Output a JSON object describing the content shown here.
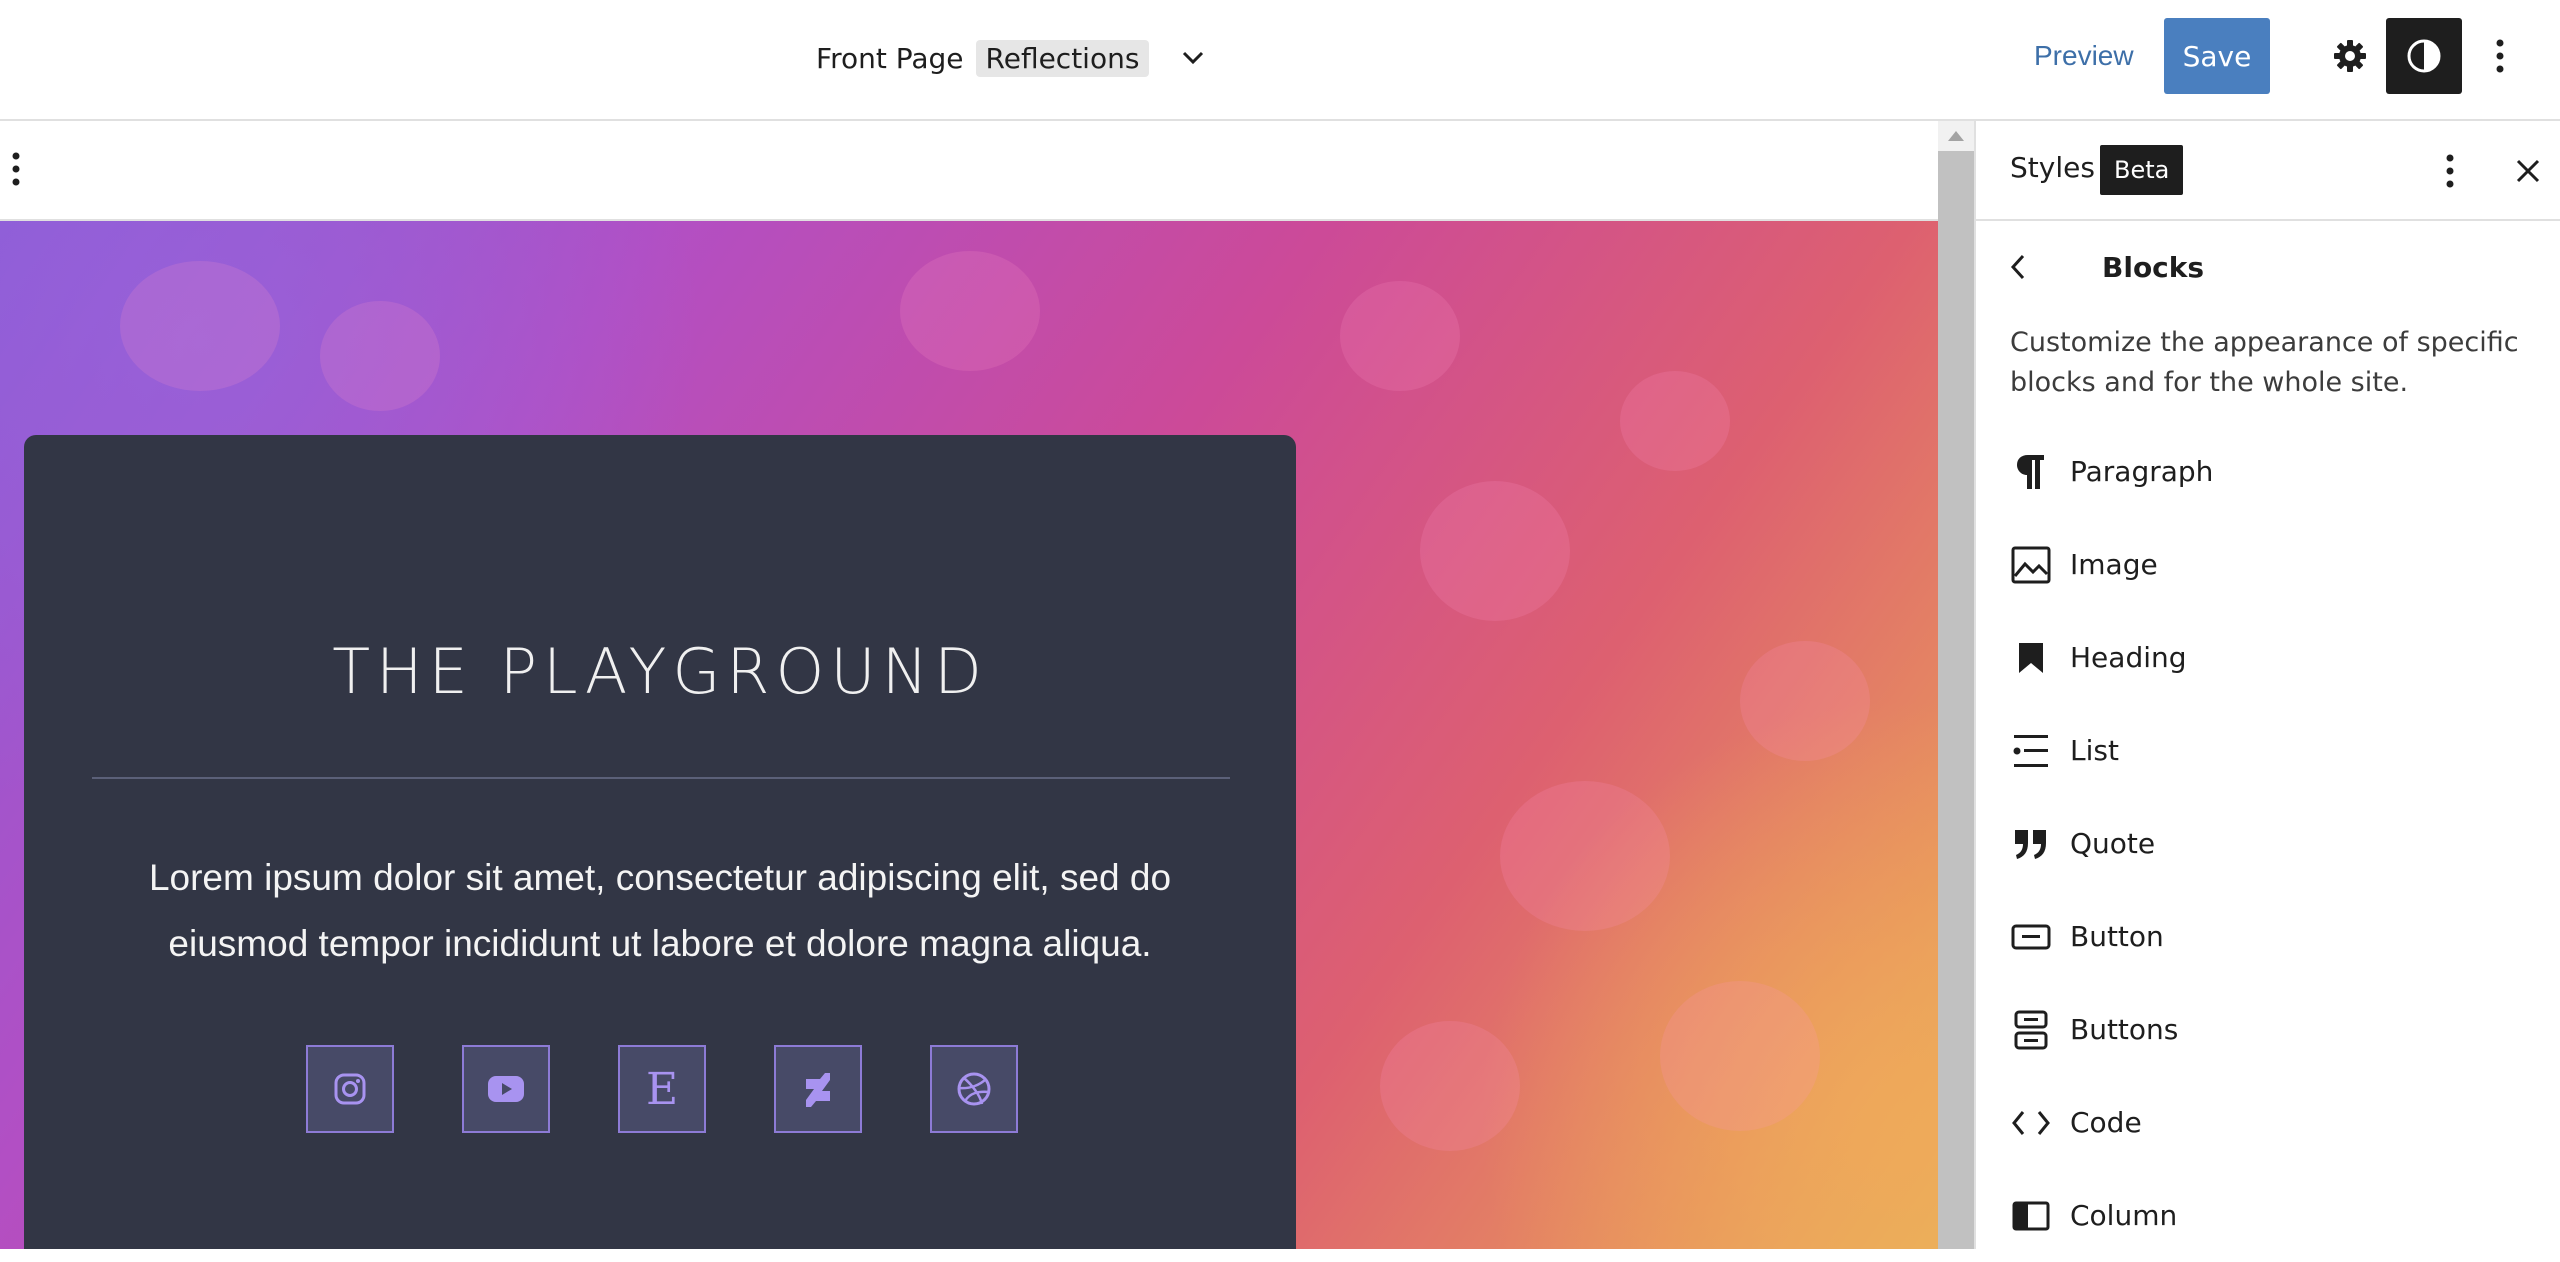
{
  "topbar": {
    "page_name": "Front Page",
    "template_badge": "Reflections",
    "preview_label": "Preview",
    "save_label": "Save"
  },
  "canvas": {
    "card_title": "THE PLAYGROUND",
    "card_text": "Lorem ipsum dolor sit amet, consectetur adipiscing elit, sed do eiusmod tempor incididunt ut labore et dolore magna aliqua.",
    "social_icons": [
      "instagram-icon",
      "youtube-icon",
      "etsy-icon",
      "deviantart-icon",
      "dribbble-icon"
    ],
    "etsy_letter": "E"
  },
  "sidebar": {
    "title": "Styles",
    "badge": "Beta",
    "section_title": "Blocks",
    "description": "Customize the appearance of specific blocks and for the whole site.",
    "blocks": [
      {
        "label": "Paragraph",
        "icon": "paragraph-icon"
      },
      {
        "label": "Image",
        "icon": "image-icon"
      },
      {
        "label": "Heading",
        "icon": "heading-icon"
      },
      {
        "label": "List",
        "icon": "list-icon"
      },
      {
        "label": "Quote",
        "icon": "quote-icon"
      },
      {
        "label": "Button",
        "icon": "button-icon"
      },
      {
        "label": "Buttons",
        "icon": "buttons-icon"
      },
      {
        "label": "Code",
        "icon": "code-icon"
      },
      {
        "label": "Column",
        "icon": "column-icon"
      }
    ]
  },
  "colors": {
    "save_blue": "#4a7fbf",
    "card_bg": "#323645",
    "social_accent": "#8d7bd6"
  }
}
